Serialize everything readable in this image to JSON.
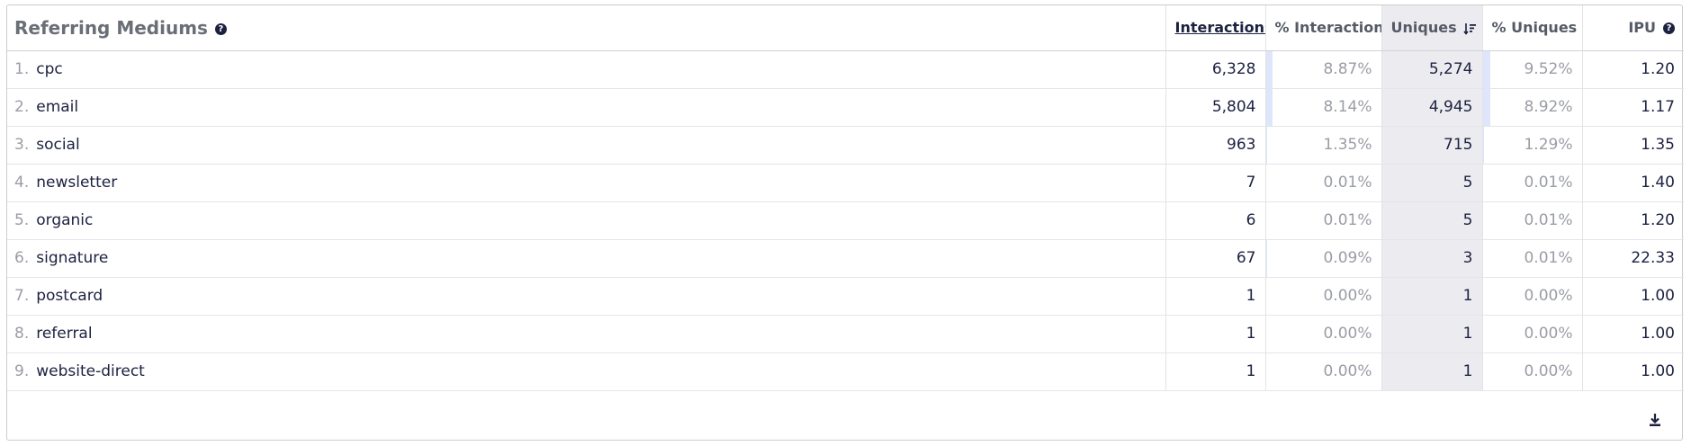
{
  "header": {
    "title": "Referring Mediums",
    "help_icon": "question-circle-icon",
    "columns": {
      "interactions": "Interactions",
      "pct_interactions": "% Interactions",
      "uniques": "Uniques",
      "pct_uniques": "% Uniques",
      "ipu": "IPU"
    },
    "sorted_by": "uniques",
    "sort_direction": "descending"
  },
  "rows": [
    {
      "index": "1.",
      "name": "cpc",
      "interactions": "6,328",
      "pct_interactions": "8.87%",
      "uniques": "5,274",
      "pct_uniques": "9.52%",
      "ipu": "1.20",
      "pct_interactions_value": 8.87,
      "pct_uniques_value": 9.52
    },
    {
      "index": "2.",
      "name": "email",
      "interactions": "5,804",
      "pct_interactions": "8.14%",
      "uniques": "4,945",
      "pct_uniques": "8.92%",
      "ipu": "1.17",
      "pct_interactions_value": 8.14,
      "pct_uniques_value": 8.92
    },
    {
      "index": "3.",
      "name": "social",
      "interactions": "963",
      "pct_interactions": "1.35%",
      "uniques": "715",
      "pct_uniques": "1.29%",
      "ipu": "1.35",
      "pct_interactions_value": 1.35,
      "pct_uniques_value": 1.29
    },
    {
      "index": "4.",
      "name": "newsletter",
      "interactions": "7",
      "pct_interactions": "0.01%",
      "uniques": "5",
      "pct_uniques": "0.01%",
      "ipu": "1.40",
      "pct_interactions_value": 0.01,
      "pct_uniques_value": 0.01
    },
    {
      "index": "5.",
      "name": "organic",
      "interactions": "6",
      "pct_interactions": "0.01%",
      "uniques": "5",
      "pct_uniques": "0.01%",
      "ipu": "1.20",
      "pct_interactions_value": 0.01,
      "pct_uniques_value": 0.01
    },
    {
      "index": "6.",
      "name": "signature",
      "interactions": "67",
      "pct_interactions": "0.09%",
      "uniques": "3",
      "pct_uniques": "0.01%",
      "ipu": "22.33",
      "pct_interactions_value": 0.09,
      "pct_uniques_value": 0.01
    },
    {
      "index": "7.",
      "name": "postcard",
      "interactions": "1",
      "pct_interactions": "0.00%",
      "uniques": "1",
      "pct_uniques": "0.00%",
      "ipu": "1.00",
      "pct_interactions_value": 0.0,
      "pct_uniques_value": 0.0
    },
    {
      "index": "8.",
      "name": "referral",
      "interactions": "1",
      "pct_interactions": "0.00%",
      "uniques": "1",
      "pct_uniques": "0.00%",
      "ipu": "1.00",
      "pct_interactions_value": 0.0,
      "pct_uniques_value": 0.0
    },
    {
      "index": "9.",
      "name": "website-direct",
      "interactions": "1",
      "pct_interactions": "0.00%",
      "uniques": "1",
      "pct_uniques": "0.00%",
      "ipu": "1.00",
      "pct_interactions_value": 0.0,
      "pct_uniques_value": 0.0
    }
  ],
  "footer": {
    "download_icon": "download-icon"
  },
  "colors": {
    "bar_fill": "#dfe6fb",
    "sorted_column_bg": "#ececf0",
    "text": "#1c2140",
    "muted": "#9a9da5"
  }
}
